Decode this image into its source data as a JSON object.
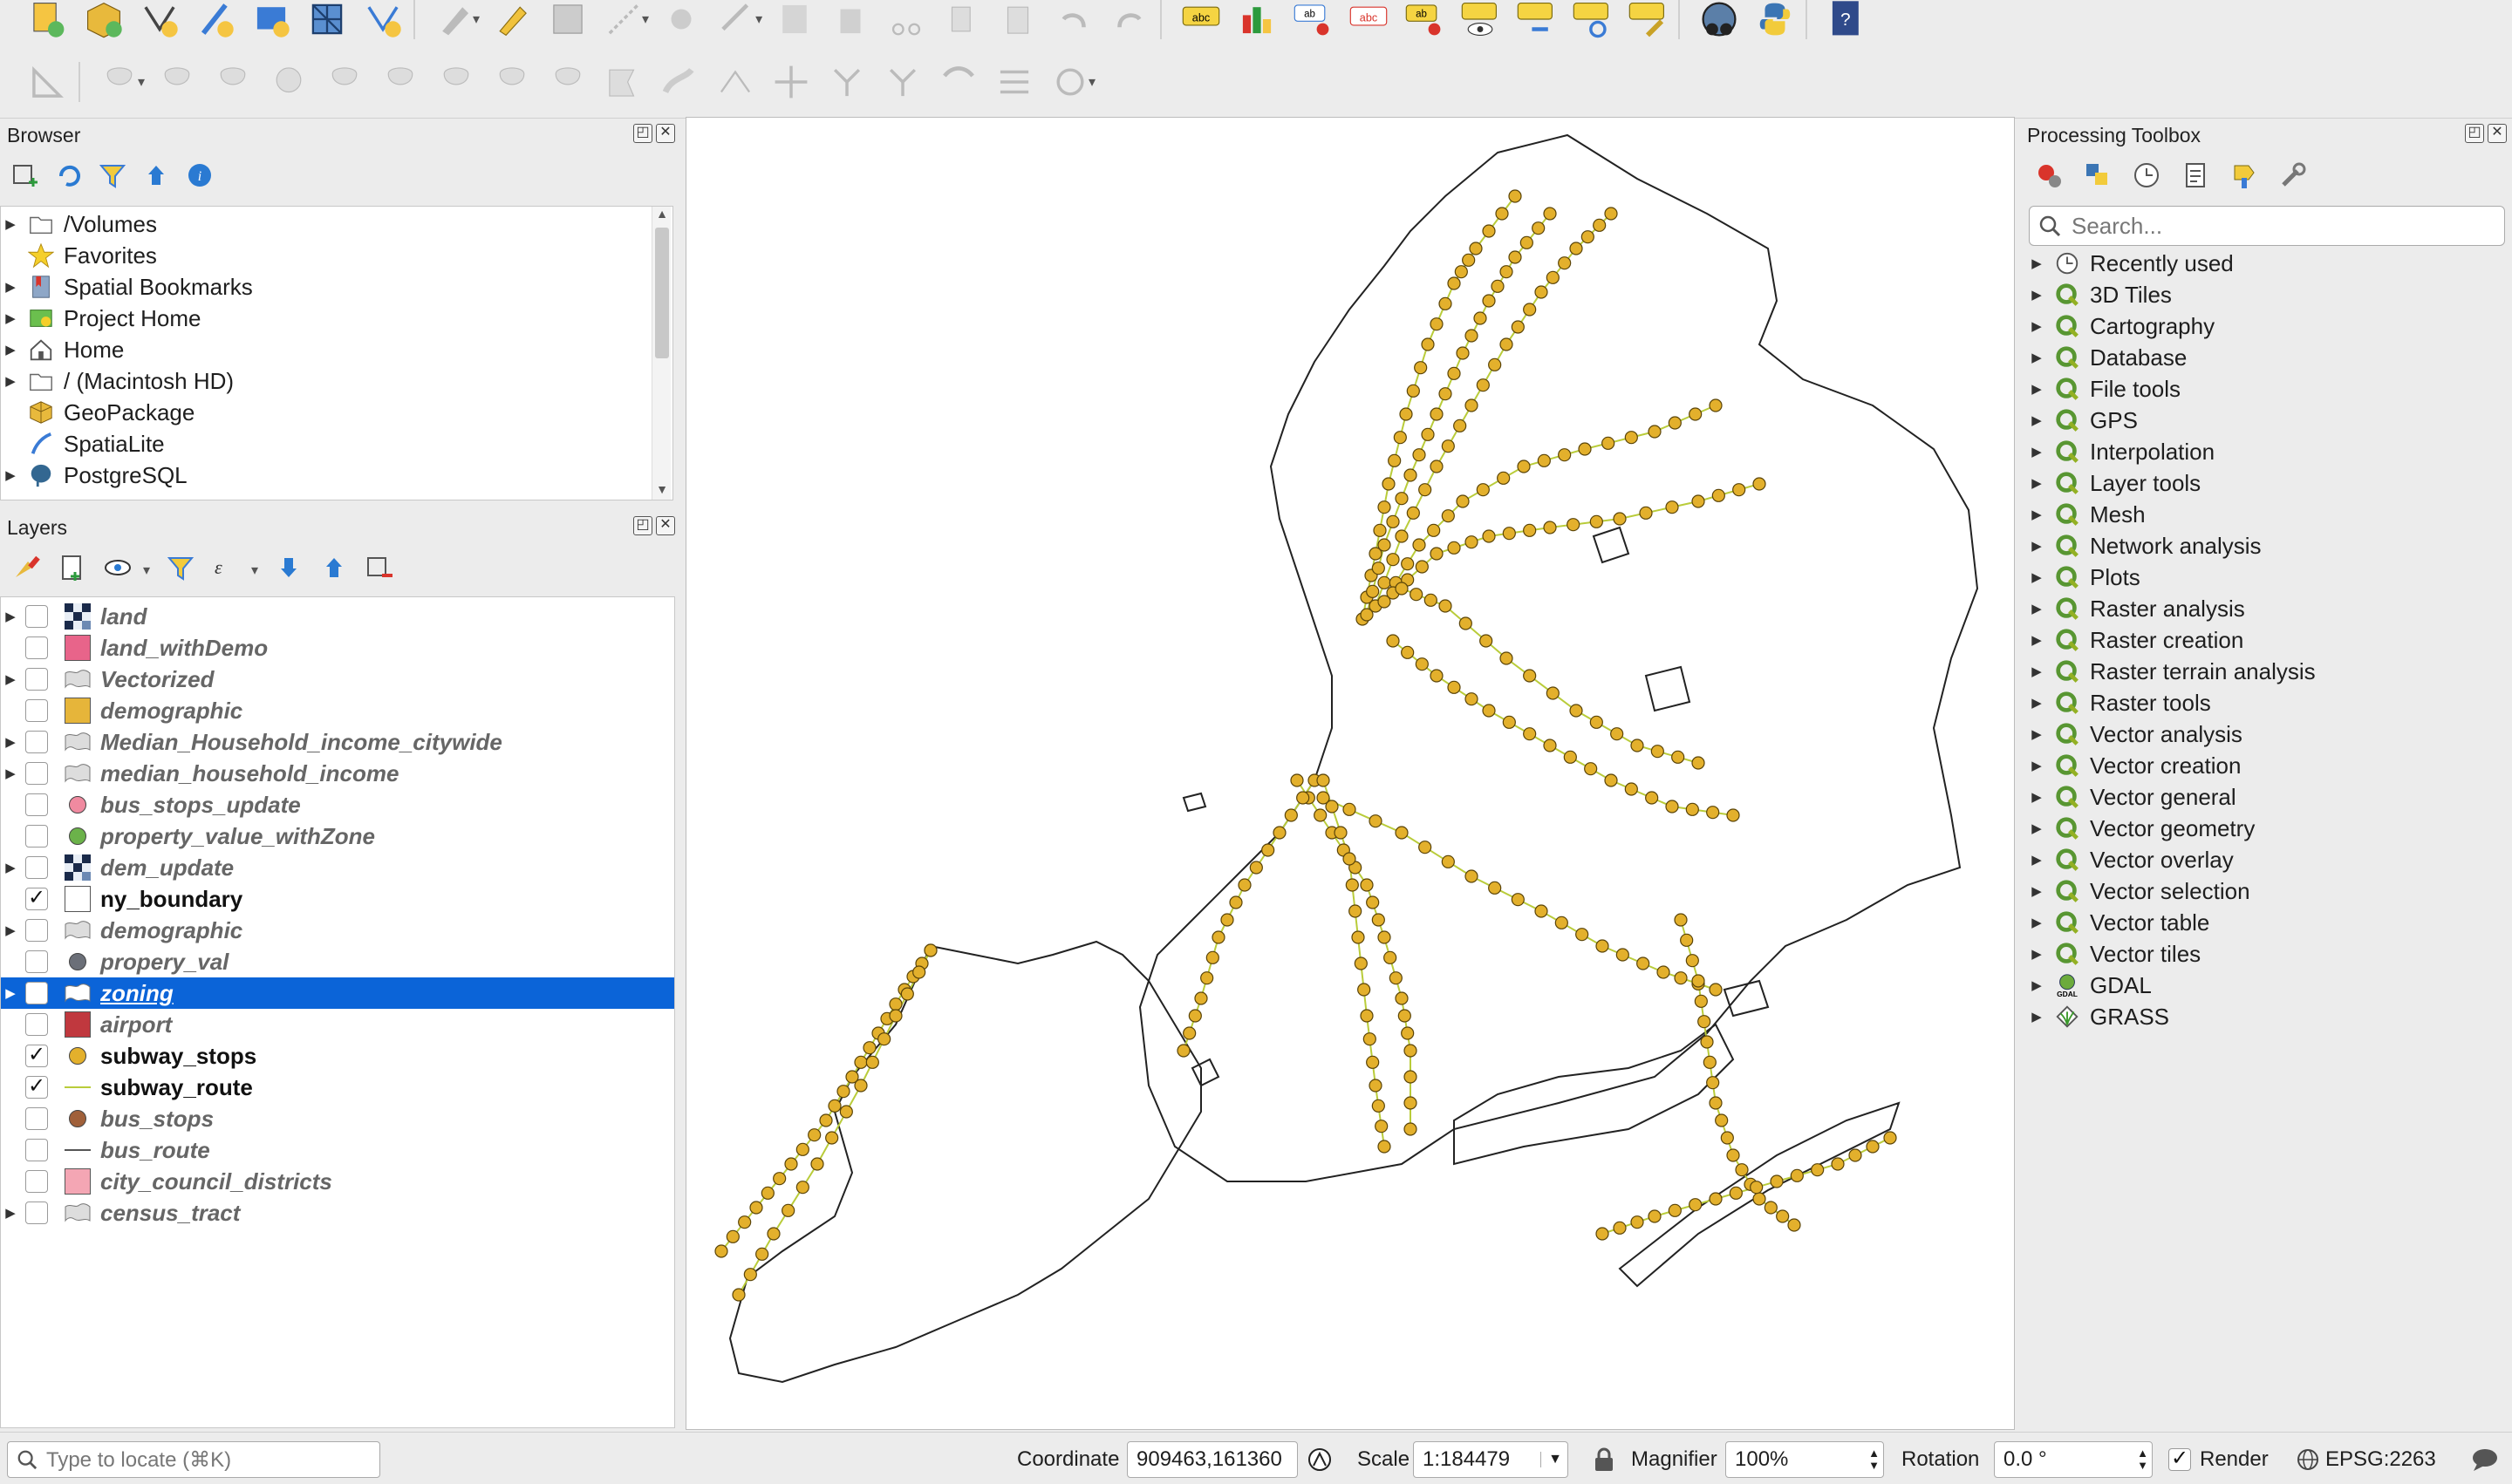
{
  "browser": {
    "title": "Browser",
    "items": [
      {
        "label": "/Volumes",
        "icon": "folder-icon",
        "expand": true
      },
      {
        "label": "Favorites",
        "icon": "star-icon",
        "expand": false
      },
      {
        "label": "Spatial Bookmarks",
        "icon": "bookmark-icon",
        "expand": true
      },
      {
        "label": "Project Home",
        "icon": "project-home-icon",
        "expand": true
      },
      {
        "label": "Home",
        "icon": "home-icon",
        "expand": true
      },
      {
        "label": "/ (Macintosh HD)",
        "icon": "folder-icon",
        "expand": true
      },
      {
        "label": "GeoPackage",
        "icon": "geopackage-icon",
        "expand": false
      },
      {
        "label": "SpatiaLite",
        "icon": "spatialite-icon",
        "expand": false
      },
      {
        "label": "PostgreSQL",
        "icon": "postgresql-icon",
        "expand": true
      }
    ]
  },
  "layers": {
    "title": "Layers",
    "items": [
      {
        "name": "land",
        "checked": false,
        "expand": true,
        "symbol": "raster",
        "color": "#1a2a4a"
      },
      {
        "name": "land_withDemo",
        "checked": false,
        "expand": false,
        "symbol": "square",
        "color": "#e8648a"
      },
      {
        "name": "Vectorized",
        "checked": false,
        "expand": true,
        "symbol": "group",
        "color": "#888888"
      },
      {
        "name": "demographic",
        "checked": false,
        "expand": false,
        "symbol": "square",
        "color": "#e6b53a"
      },
      {
        "name": "Median_Household_income_citywide",
        "checked": false,
        "expand": true,
        "symbol": "group",
        "color": "#888888"
      },
      {
        "name": "median_household_income",
        "checked": false,
        "expand": true,
        "symbol": "group",
        "color": "#888888"
      },
      {
        "name": "bus_stops_update",
        "checked": false,
        "expand": false,
        "symbol": "dot",
        "color": "#f08aa0"
      },
      {
        "name": "property_value_withZone",
        "checked": false,
        "expand": false,
        "symbol": "dot",
        "color": "#6bb24a"
      },
      {
        "name": "dem_update",
        "checked": false,
        "expand": true,
        "symbol": "raster",
        "color": "#1a2a4a"
      },
      {
        "name": "ny_boundary",
        "checked": true,
        "expand": false,
        "symbol": "square",
        "color": "#ffffff"
      },
      {
        "name": "demographic",
        "checked": false,
        "expand": true,
        "symbol": "group",
        "color": "#888888"
      },
      {
        "name": "propery_val",
        "checked": false,
        "expand": false,
        "symbol": "dot",
        "color": "#6b6f78"
      },
      {
        "name": "zoning",
        "checked": false,
        "expand": true,
        "symbol": "group",
        "color": "#ffffff",
        "selected": true
      },
      {
        "name": "airport",
        "checked": false,
        "expand": false,
        "symbol": "square",
        "color": "#c0383e"
      },
      {
        "name": "subway_stops",
        "checked": true,
        "expand": false,
        "symbol": "dot",
        "color": "#e3b02c"
      },
      {
        "name": "subway_route",
        "checked": true,
        "expand": false,
        "symbol": "line",
        "color": "#b9cc3a"
      },
      {
        "name": "bus_stops",
        "checked": false,
        "expand": false,
        "symbol": "dot",
        "color": "#a0603a"
      },
      {
        "name": "bus_route",
        "checked": false,
        "expand": false,
        "symbol": "line",
        "color": "#555555"
      },
      {
        "name": "city_council_districts",
        "checked": false,
        "expand": false,
        "symbol": "square",
        "color": "#f4a6b4"
      },
      {
        "name": "census_tract",
        "checked": false,
        "expand": true,
        "symbol": "group",
        "color": "#888888"
      }
    ]
  },
  "toolbox": {
    "title": "Processing Toolbox",
    "search_placeholder": "Search...",
    "items": [
      {
        "label": "Recently used",
        "icon": "clock-icon"
      },
      {
        "label": "3D Tiles",
        "icon": "qgis-icon"
      },
      {
        "label": "Cartography",
        "icon": "qgis-icon"
      },
      {
        "label": "Database",
        "icon": "qgis-icon"
      },
      {
        "label": "File tools",
        "icon": "qgis-icon"
      },
      {
        "label": "GPS",
        "icon": "qgis-icon"
      },
      {
        "label": "Interpolation",
        "icon": "qgis-icon"
      },
      {
        "label": "Layer tools",
        "icon": "qgis-icon"
      },
      {
        "label": "Mesh",
        "icon": "qgis-icon"
      },
      {
        "label": "Network analysis",
        "icon": "qgis-icon"
      },
      {
        "label": "Plots",
        "icon": "qgis-icon"
      },
      {
        "label": "Raster analysis",
        "icon": "qgis-icon"
      },
      {
        "label": "Raster creation",
        "icon": "qgis-icon"
      },
      {
        "label": "Raster terrain analysis",
        "icon": "qgis-icon"
      },
      {
        "label": "Raster tools",
        "icon": "qgis-icon"
      },
      {
        "label": "Vector analysis",
        "icon": "qgis-icon"
      },
      {
        "label": "Vector creation",
        "icon": "qgis-icon"
      },
      {
        "label": "Vector general",
        "icon": "qgis-icon"
      },
      {
        "label": "Vector geometry",
        "icon": "qgis-icon"
      },
      {
        "label": "Vector overlay",
        "icon": "qgis-icon"
      },
      {
        "label": "Vector selection",
        "icon": "qgis-icon"
      },
      {
        "label": "Vector table",
        "icon": "qgis-icon"
      },
      {
        "label": "Vector tiles",
        "icon": "qgis-icon"
      },
      {
        "label": "GDAL",
        "icon": "gdal-icon"
      },
      {
        "label": "GRASS",
        "icon": "grass-icon"
      }
    ]
  },
  "statusbar": {
    "locator_placeholder": "Type to locate (⌘K)",
    "coordinate_label": "Coordinate",
    "coordinate_value": "909463,161360",
    "scale_label": "Scale",
    "scale_value": "1:184479",
    "magnifier_label": "Magnifier",
    "magnifier_value": "100%",
    "rotation_label": "Rotation",
    "rotation_value": "0.0 °",
    "render_label": "Render",
    "render_checked": true,
    "crs_label": "EPSG:2263"
  },
  "map": {
    "stop_color": "#e3b02c",
    "route_color": "#b9cc3a",
    "boundary_color": "#222222"
  }
}
